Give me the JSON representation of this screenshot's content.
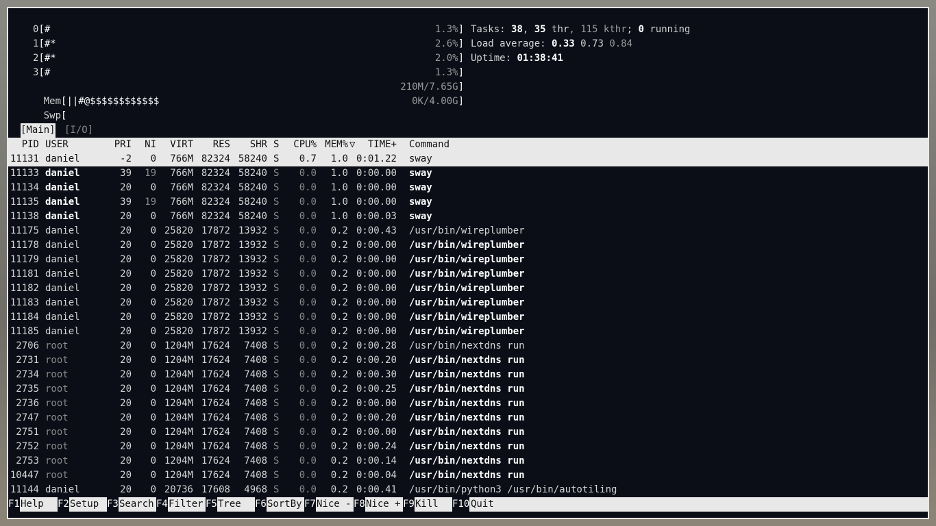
{
  "cpus": [
    {
      "id": "0",
      "bar": "#",
      "pct": "1.3%"
    },
    {
      "id": "1",
      "bar": "#*",
      "pct": "2.6%"
    },
    {
      "id": "2",
      "bar": "#*",
      "pct": "2.0%"
    },
    {
      "id": "3",
      "bar": "#",
      "pct": "1.3%"
    }
  ],
  "mem": {
    "label": "Mem",
    "bar": "||#@$$$$$$$$$$$$",
    "value": "210M/7.65G"
  },
  "swp": {
    "label": "Swp",
    "bar": "",
    "value": "0K/4.00G"
  },
  "tasks": {
    "label": "Tasks:",
    "tasks": "38",
    "thr": "35",
    "thr_label": "thr",
    "kthr": "115 kthr",
    "running": "0",
    "running_label": "running"
  },
  "load": {
    "label": "Load average:",
    "l1": "0.33",
    "l5": "0.73",
    "l15": "0.84"
  },
  "uptime": {
    "label": "Uptime:",
    "value": "01:38:41"
  },
  "tabs": {
    "main": "[Main]",
    "io": "[I/O]"
  },
  "columns": {
    "pid": "PID",
    "user": "USER",
    "pri": "PRI",
    "ni": "NI",
    "virt": "VIRT",
    "res": "RES",
    "shr": "SHR",
    "s": "S",
    "cpu": "CPU%",
    "mem": "MEM%",
    "sort": "▽",
    "time": "TIME+",
    "cmd": "Command"
  },
  "processes": [
    {
      "pid": "11131",
      "user": "daniel",
      "pri": "-2",
      "ni": "0",
      "virt": "766M",
      "res": "82324",
      "shr": "58240",
      "s": "S",
      "cpu": "0.7",
      "mem": "1.0",
      "time": "0:01.22",
      "cmd": "sway"
    },
    {
      "pid": "11133",
      "user": "daniel",
      "pri": "39",
      "ni": "19",
      "virt": "766M",
      "res": "82324",
      "shr": "58240",
      "s": "S",
      "cpu": "0.0",
      "mem": "1.0",
      "time": "0:00.00",
      "cmd": "sway"
    },
    {
      "pid": "11134",
      "user": "daniel",
      "pri": "20",
      "ni": "0",
      "virt": "766M",
      "res": "82324",
      "shr": "58240",
      "s": "S",
      "cpu": "0.0",
      "mem": "1.0",
      "time": "0:00.00",
      "cmd": "sway"
    },
    {
      "pid": "11135",
      "user": "daniel",
      "pri": "39",
      "ni": "19",
      "virt": "766M",
      "res": "82324",
      "shr": "58240",
      "s": "S",
      "cpu": "0.0",
      "mem": "1.0",
      "time": "0:00.00",
      "cmd": "sway"
    },
    {
      "pid": "11138",
      "user": "daniel",
      "pri": "20",
      "ni": "0",
      "virt": "766M",
      "res": "82324",
      "shr": "58240",
      "s": "S",
      "cpu": "0.0",
      "mem": "1.0",
      "time": "0:00.03",
      "cmd": "sway"
    },
    {
      "pid": "11175",
      "user": "daniel",
      "pri": "20",
      "ni": "0",
      "virt": "25820",
      "res": "17872",
      "shr": "13932",
      "s": "S",
      "cpu": "0.0",
      "mem": "0.2",
      "time": "0:00.43",
      "cmd": "/usr/bin/wireplumber"
    },
    {
      "pid": "11178",
      "user": "daniel",
      "pri": "20",
      "ni": "0",
      "virt": "25820",
      "res": "17872",
      "shr": "13932",
      "s": "S",
      "cpu": "0.0",
      "mem": "0.2",
      "time": "0:00.00",
      "cmd": "/usr/bin/wireplumber"
    },
    {
      "pid": "11179",
      "user": "daniel",
      "pri": "20",
      "ni": "0",
      "virt": "25820",
      "res": "17872",
      "shr": "13932",
      "s": "S",
      "cpu": "0.0",
      "mem": "0.2",
      "time": "0:00.00",
      "cmd": "/usr/bin/wireplumber"
    },
    {
      "pid": "11181",
      "user": "daniel",
      "pri": "20",
      "ni": "0",
      "virt": "25820",
      "res": "17872",
      "shr": "13932",
      "s": "S",
      "cpu": "0.0",
      "mem": "0.2",
      "time": "0:00.00",
      "cmd": "/usr/bin/wireplumber"
    },
    {
      "pid": "11182",
      "user": "daniel",
      "pri": "20",
      "ni": "0",
      "virt": "25820",
      "res": "17872",
      "shr": "13932",
      "s": "S",
      "cpu": "0.0",
      "mem": "0.2",
      "time": "0:00.00",
      "cmd": "/usr/bin/wireplumber"
    },
    {
      "pid": "11183",
      "user": "daniel",
      "pri": "20",
      "ni": "0",
      "virt": "25820",
      "res": "17872",
      "shr": "13932",
      "s": "S",
      "cpu": "0.0",
      "mem": "0.2",
      "time": "0:00.00",
      "cmd": "/usr/bin/wireplumber"
    },
    {
      "pid": "11184",
      "user": "daniel",
      "pri": "20",
      "ni": "0",
      "virt": "25820",
      "res": "17872",
      "shr": "13932",
      "s": "S",
      "cpu": "0.0",
      "mem": "0.2",
      "time": "0:00.00",
      "cmd": "/usr/bin/wireplumber"
    },
    {
      "pid": "11185",
      "user": "daniel",
      "pri": "20",
      "ni": "0",
      "virt": "25820",
      "res": "17872",
      "shr": "13932",
      "s": "S",
      "cpu": "0.0",
      "mem": "0.2",
      "time": "0:00.00",
      "cmd": "/usr/bin/wireplumber"
    },
    {
      "pid": "2706",
      "user": "root",
      "pri": "20",
      "ni": "0",
      "virt": "1204M",
      "res": "17624",
      "shr": "7408",
      "s": "S",
      "cpu": "0.0",
      "mem": "0.2",
      "time": "0:00.28",
      "cmd": "/usr/bin/nextdns run"
    },
    {
      "pid": "2731",
      "user": "root",
      "pri": "20",
      "ni": "0",
      "virt": "1204M",
      "res": "17624",
      "shr": "7408",
      "s": "S",
      "cpu": "0.0",
      "mem": "0.2",
      "time": "0:00.20",
      "cmd": "/usr/bin/nextdns run"
    },
    {
      "pid": "2734",
      "user": "root",
      "pri": "20",
      "ni": "0",
      "virt": "1204M",
      "res": "17624",
      "shr": "7408",
      "s": "S",
      "cpu": "0.0",
      "mem": "0.2",
      "time": "0:00.30",
      "cmd": "/usr/bin/nextdns run"
    },
    {
      "pid": "2735",
      "user": "root",
      "pri": "20",
      "ni": "0",
      "virt": "1204M",
      "res": "17624",
      "shr": "7408",
      "s": "S",
      "cpu": "0.0",
      "mem": "0.2",
      "time": "0:00.25",
      "cmd": "/usr/bin/nextdns run"
    },
    {
      "pid": "2736",
      "user": "root",
      "pri": "20",
      "ni": "0",
      "virt": "1204M",
      "res": "17624",
      "shr": "7408",
      "s": "S",
      "cpu": "0.0",
      "mem": "0.2",
      "time": "0:00.00",
      "cmd": "/usr/bin/nextdns run"
    },
    {
      "pid": "2747",
      "user": "root",
      "pri": "20",
      "ni": "0",
      "virt": "1204M",
      "res": "17624",
      "shr": "7408",
      "s": "S",
      "cpu": "0.0",
      "mem": "0.2",
      "time": "0:00.20",
      "cmd": "/usr/bin/nextdns run"
    },
    {
      "pid": "2751",
      "user": "root",
      "pri": "20",
      "ni": "0",
      "virt": "1204M",
      "res": "17624",
      "shr": "7408",
      "s": "S",
      "cpu": "0.0",
      "mem": "0.2",
      "time": "0:00.00",
      "cmd": "/usr/bin/nextdns run"
    },
    {
      "pid": "2752",
      "user": "root",
      "pri": "20",
      "ni": "0",
      "virt": "1204M",
      "res": "17624",
      "shr": "7408",
      "s": "S",
      "cpu": "0.0",
      "mem": "0.2",
      "time": "0:00.24",
      "cmd": "/usr/bin/nextdns run"
    },
    {
      "pid": "2753",
      "user": "root",
      "pri": "20",
      "ni": "0",
      "virt": "1204M",
      "res": "17624",
      "shr": "7408",
      "s": "S",
      "cpu": "0.0",
      "mem": "0.2",
      "time": "0:00.14",
      "cmd": "/usr/bin/nextdns run"
    },
    {
      "pid": "10447",
      "user": "root",
      "pri": "20",
      "ni": "0",
      "virt": "1204M",
      "res": "17624",
      "shr": "7408",
      "s": "S",
      "cpu": "0.0",
      "mem": "0.2",
      "time": "0:00.04",
      "cmd": "/usr/bin/nextdns run"
    },
    {
      "pid": "11144",
      "user": "daniel",
      "pri": "20",
      "ni": "0",
      "virt": "20736",
      "res": "17608",
      "shr": "4968",
      "s": "S",
      "cpu": "0.0",
      "mem": "0.2",
      "time": "0:00.41",
      "cmd": "/usr/bin/python3 /usr/bin/autotiling"
    }
  ],
  "footer": [
    {
      "key": "F1",
      "label": "Help  "
    },
    {
      "key": "F2",
      "label": "Setup "
    },
    {
      "key": "F3",
      "label": "Search"
    },
    {
      "key": "F4",
      "label": "Filter"
    },
    {
      "key": "F5",
      "label": "Tree  "
    },
    {
      "key": "F6",
      "label": "SortBy"
    },
    {
      "key": "F7",
      "label": "Nice -"
    },
    {
      "key": "F8",
      "label": "Nice +"
    },
    {
      "key": "F9",
      "label": "Kill  "
    },
    {
      "key": "F10",
      "label": "Quit"
    }
  ]
}
